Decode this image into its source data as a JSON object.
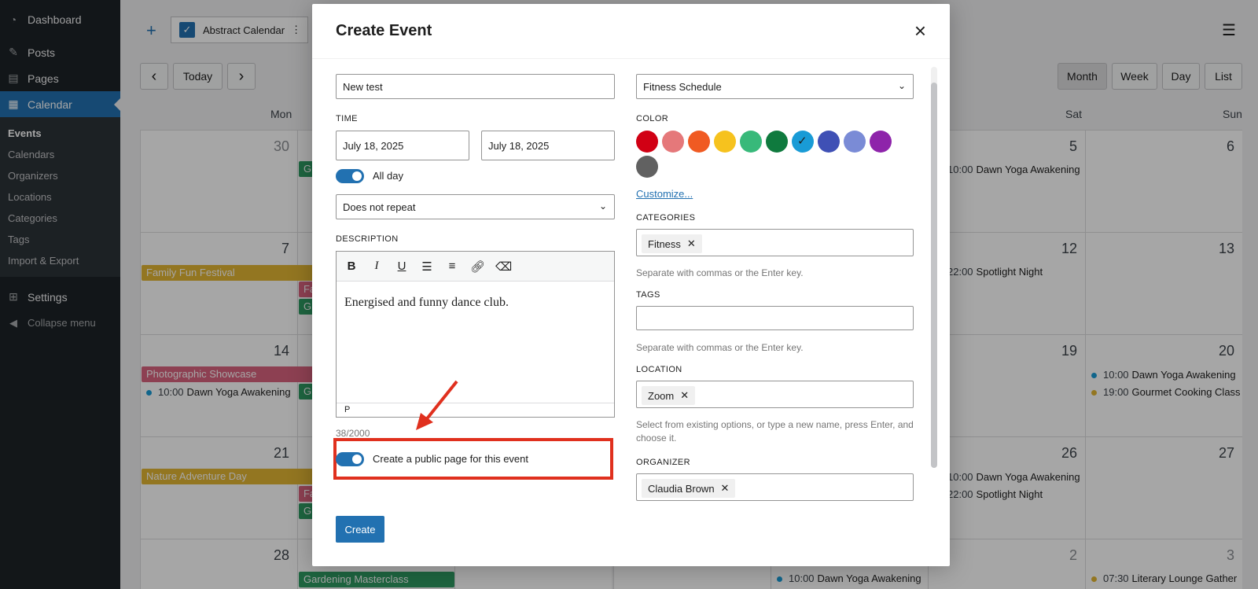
{
  "sidebar": {
    "dashboard": "Dashboard",
    "posts": "Posts",
    "pages": "Pages",
    "calendar": "Calendar",
    "sub": [
      "Events",
      "Calendars",
      "Organizers",
      "Locations",
      "Categories",
      "Tags",
      "Import & Export"
    ],
    "settings": "Settings",
    "collapse": "Collapse menu"
  },
  "topbar": {
    "add_icon": "+",
    "calendar_filter_label": "Abstract Calendar",
    "menu_icon": "☰"
  },
  "nav": {
    "prev": "‹",
    "today": "Today",
    "next": "›",
    "views": [
      "Month",
      "Week",
      "Day",
      "List"
    ],
    "selected_view": "Month"
  },
  "calendar": {
    "days": [
      "Mon",
      "Sat",
      "Sun"
    ],
    "weeks": [
      {
        "mon": "30",
        "sat": "5",
        "sun": "6"
      },
      {
        "mon": "7",
        "sat": "12",
        "sun": "13"
      },
      {
        "mon": "14",
        "sat": "19",
        "sun": "20"
      },
      {
        "mon": "21",
        "sat": "26",
        "sun": "27"
      },
      {
        "mon": "28",
        "sat": "2",
        "sun": "3"
      }
    ],
    "bars": {
      "family_fun": "Family Fun Festival",
      "photographic": "Photographic Showcase",
      "nature": "Nature Adventure Day",
      "gardening": "Gardening Masterclass",
      "frag_g": "G",
      "frag_f": "Fa"
    },
    "events": {
      "yoga": "Dawn Yoga Awakening",
      "spotlight": "Spotlight Night",
      "gourmet": "Gourmet Cooking Class",
      "literary": "Literary Lounge Gather",
      "t1000": "10:00",
      "t2200": "22:00",
      "t1900": "19:00",
      "t0730": "07:30"
    }
  },
  "modal": {
    "title": "Create Event",
    "close_icon": "×",
    "title_value": "New test",
    "calendar_select": "Fitness Schedule",
    "time_label": "TIME",
    "start_date": "July 18, 2025",
    "end_date": "July 18, 2025",
    "all_day": "All day",
    "repeat": "Does not repeat",
    "description_label": "DESCRIPTION",
    "description_text": "Energised and funny dance club.",
    "editor_tag": "P",
    "char_count": "38/2000",
    "public_page": "Create a public page for this event",
    "color_label": "COLOR",
    "colors": [
      "#d10014",
      "#e5787a",
      "#f05a22",
      "#f6c21e",
      "#38b97a",
      "#0f7a3e",
      "#199bd6",
      "#3f50b5",
      "#7a8bd6",
      "#8e24aa",
      "#616161"
    ],
    "selected_color": "#199bd6",
    "customize": "Customize...",
    "categories_label": "CATEGORIES",
    "category_chip": "Fitness",
    "categories_help": "Separate with commas or the Enter key.",
    "tags_label": "TAGS",
    "tags_help": "Separate with commas or the Enter key.",
    "location_label": "LOCATION",
    "location_chip": "Zoom",
    "location_help": "Select from existing options, or type a new name, press Enter, and choose it.",
    "organizer_label": "ORGANIZER",
    "organizer_chip": "Claudia Brown",
    "create": "Create"
  }
}
